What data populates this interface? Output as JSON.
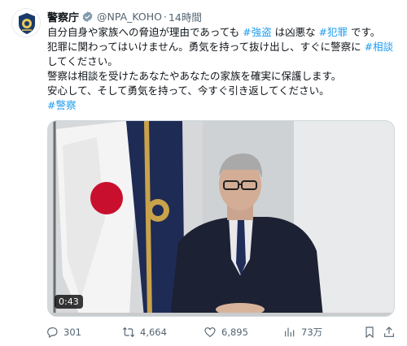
{
  "account": {
    "name": "警察庁",
    "handle": "@NPA_KOHO",
    "separator": "·",
    "time": "14時間"
  },
  "tweet": {
    "line1": {
      "a": "自分自身や家族への脅迫が理由であっても ",
      "tag1": "#強盗",
      "b": " は凶悪な ",
      "tag2": "#犯罪",
      "c": " です。"
    },
    "line2": {
      "a": "犯罪に関わってはいけません。勇気を持って抜け出し、すぐに警察に ",
      "tag": "#相談"
    },
    "line3": "してください。",
    "line4": "警察は相談を受けたあなたやあなたの家族を確実に保護します。",
    "line5": "安心して、そして勇気を持って、今すぐ引き返してください。",
    "line6": "#警察"
  },
  "video": {
    "duration": "0:43"
  },
  "actions": {
    "replies": "301",
    "reposts": "4,664",
    "likes": "6,895",
    "views": "73万"
  },
  "colors": {
    "link": "#1d9bf0",
    "verified": "#829aab",
    "muted": "#536471"
  },
  "icons": [
    "verified-badge-icon",
    "reply-icon",
    "repost-icon",
    "like-icon",
    "views-icon",
    "bookmark-icon",
    "share-icon"
  ]
}
